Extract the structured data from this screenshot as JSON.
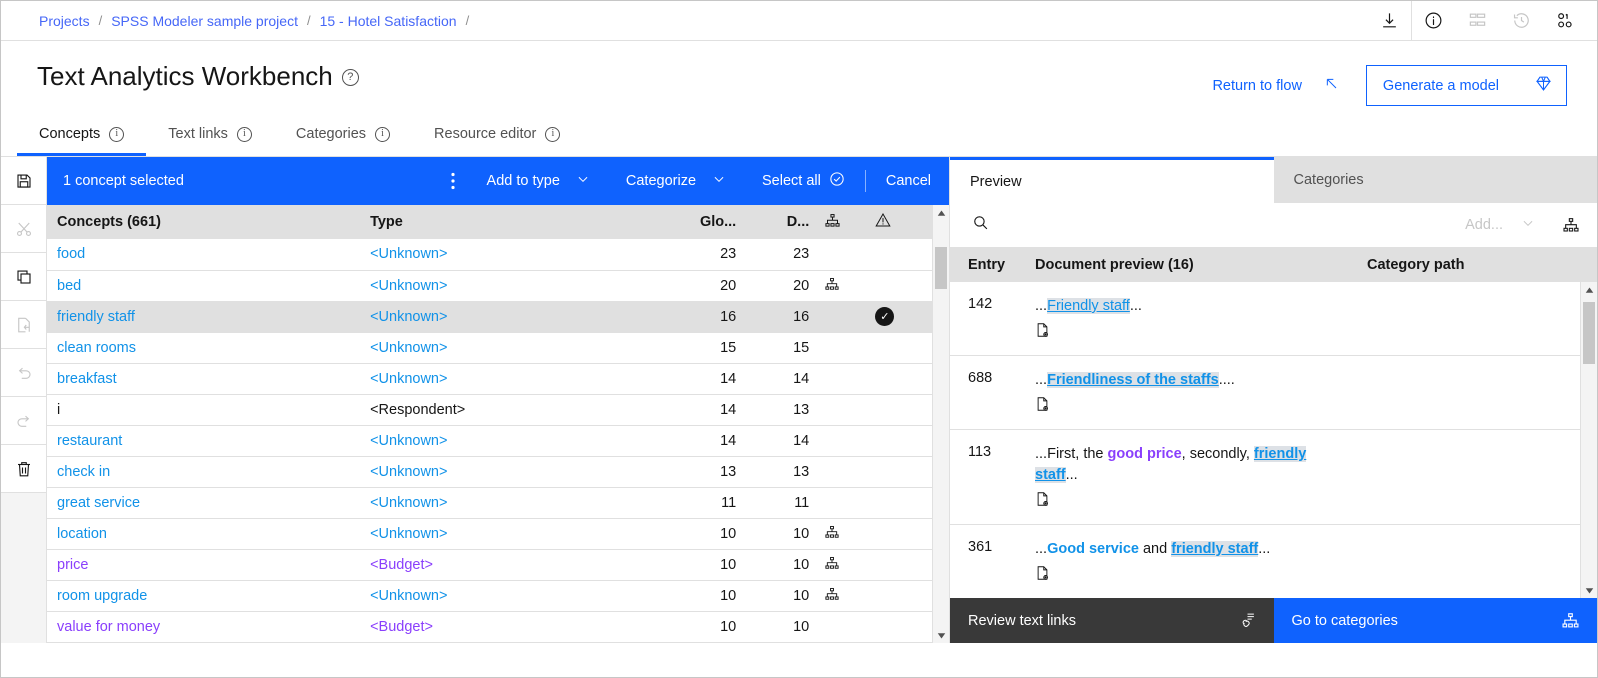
{
  "breadcrumb": {
    "items": [
      "Projects",
      "SPSS Modeler sample project",
      "15 - Hotel Satisfaction"
    ],
    "separator": "/"
  },
  "topbar_icons": [
    "download-icon",
    "info-icon",
    "flow-icon",
    "history-icon",
    "data-icon"
  ],
  "header": {
    "title": "Text Analytics Workbench",
    "help_icon": "help-icon",
    "return_to_flow": "Return to flow",
    "return_icon": "arrow-up-left-icon",
    "generate_model": "Generate a model",
    "generate_icon": "gem-icon"
  },
  "tabs": [
    {
      "label": "Concepts",
      "active": true
    },
    {
      "label": "Text links",
      "active": false
    },
    {
      "label": "Categories",
      "active": false
    },
    {
      "label": "Resource editor",
      "active": false
    }
  ],
  "rail": [
    {
      "name": "save-icon",
      "disabled": false
    },
    {
      "name": "cut-icon",
      "disabled": true
    },
    {
      "name": "copy-icon",
      "disabled": false
    },
    {
      "name": "paste-icon",
      "disabled": true
    },
    {
      "name": "undo-icon",
      "disabled": true
    },
    {
      "name": "redo-icon",
      "disabled": true
    },
    {
      "name": "delete-icon",
      "disabled": false
    }
  ],
  "selection_toolbar": {
    "count_label": "1 concept selected",
    "overflow_icon": "overflow-menu-icon",
    "add_to_type": "Add to type",
    "categorize": "Categorize",
    "select_all": "Select all",
    "select_all_icon": "checkmark-circle-icon",
    "cancel": "Cancel",
    "accent": "#0f62fe"
  },
  "concepts_table": {
    "columns": [
      "Concepts (661)",
      "Type",
      "Glo...",
      "D...",
      "hierarchy-icon",
      "warning-icon"
    ],
    "rows": [
      {
        "concept": "food",
        "concept_style": "link",
        "type": "<Unknown>",
        "type_style": "link",
        "global": "23",
        "docs": "23",
        "hier": false,
        "selected": false
      },
      {
        "concept": "bed",
        "concept_style": "link",
        "type": "<Unknown>",
        "type_style": "link",
        "global": "20",
        "docs": "20",
        "hier": true,
        "selected": false
      },
      {
        "concept": "friendly staff",
        "concept_style": "link",
        "type": "<Unknown>",
        "type_style": "link",
        "global": "16",
        "docs": "16",
        "hier": false,
        "selected": true
      },
      {
        "concept": "clean rooms",
        "concept_style": "link",
        "type": "<Unknown>",
        "type_style": "link",
        "global": "15",
        "docs": "15",
        "hier": false,
        "selected": false
      },
      {
        "concept": "breakfast",
        "concept_style": "link",
        "type": "<Unknown>",
        "type_style": "link",
        "global": "14",
        "docs": "14",
        "hier": false,
        "selected": false
      },
      {
        "concept": "i",
        "concept_style": "plain",
        "type": "<Respondent>",
        "type_style": "plain",
        "global": "14",
        "docs": "13",
        "hier": false,
        "selected": false
      },
      {
        "concept": "restaurant",
        "concept_style": "link",
        "type": "<Unknown>",
        "type_style": "link",
        "global": "14",
        "docs": "14",
        "hier": false,
        "selected": false
      },
      {
        "concept": "check in",
        "concept_style": "link",
        "type": "<Unknown>",
        "type_style": "link",
        "global": "13",
        "docs": "13",
        "hier": false,
        "selected": false
      },
      {
        "concept": "great service",
        "concept_style": "link",
        "type": "<Unknown>",
        "type_style": "link",
        "global": "11",
        "docs": "11",
        "hier": false,
        "selected": false
      },
      {
        "concept": "location",
        "concept_style": "link",
        "type": "<Unknown>",
        "type_style": "link",
        "global": "10",
        "docs": "10",
        "hier": true,
        "selected": false
      },
      {
        "concept": "price",
        "concept_style": "visited",
        "type": "<Budget>",
        "type_style": "visited",
        "global": "10",
        "docs": "10",
        "hier": true,
        "selected": false
      },
      {
        "concept": "room upgrade",
        "concept_style": "link",
        "type": "<Unknown>",
        "type_style": "link",
        "global": "10",
        "docs": "10",
        "hier": true,
        "selected": false
      },
      {
        "concept": "value for money",
        "concept_style": "visited",
        "type": "<Budget>",
        "type_style": "visited",
        "global": "10",
        "docs": "10",
        "hier": false,
        "selected": false
      }
    ]
  },
  "preview_panel": {
    "tabs": [
      {
        "label": "Preview",
        "active": true
      },
      {
        "label": "Categories",
        "active": false
      }
    ],
    "search_icon": "search-icon",
    "add_label": "Add...",
    "add_chevron": "chevron-down-icon",
    "hierarchy_icon": "hierarchy-icon",
    "columns": [
      "Entry",
      "Document preview (16)",
      "Category path"
    ],
    "rows": [
      {
        "entry": "142",
        "category_path": "",
        "parts": [
          {
            "text": "...",
            "style": "plain"
          },
          {
            "text": "Friendly staff",
            "style": "highlight"
          },
          {
            "text": "...",
            "style": "plain"
          }
        ]
      },
      {
        "entry": "688",
        "category_path": "",
        "parts": [
          {
            "text": "...",
            "style": "plain"
          },
          {
            "text": "Friendliness of the staffs",
            "style": "highlight-bold"
          },
          {
            "text": "....",
            "style": "plain"
          }
        ]
      },
      {
        "entry": "113",
        "category_path": "",
        "parts": [
          {
            "text": "...First, the ",
            "style": "plain"
          },
          {
            "text": "good price",
            "style": "purple"
          },
          {
            "text": ", secondly, ",
            "style": "plain"
          },
          {
            "text": "friendly staff",
            "style": "highlight-bold"
          },
          {
            "text": "...",
            "style": "plain"
          }
        ]
      },
      {
        "entry": "361",
        "category_path": "",
        "parts": [
          {
            "text": "...",
            "style": "plain"
          },
          {
            "text": "Good service",
            "style": "blue"
          },
          {
            "text": " and ",
            "style": "plain"
          },
          {
            "text": "friendly staff",
            "style": "highlight-bold"
          },
          {
            "text": "...",
            "style": "plain"
          }
        ]
      }
    ],
    "footer": {
      "review_text_links": "Review text links",
      "review_icon": "text-link-icon",
      "go_to_categories": "Go to categories",
      "categories_icon": "hierarchy-icon",
      "dark_color": "#393939",
      "blue_color": "#0f62fe"
    }
  }
}
